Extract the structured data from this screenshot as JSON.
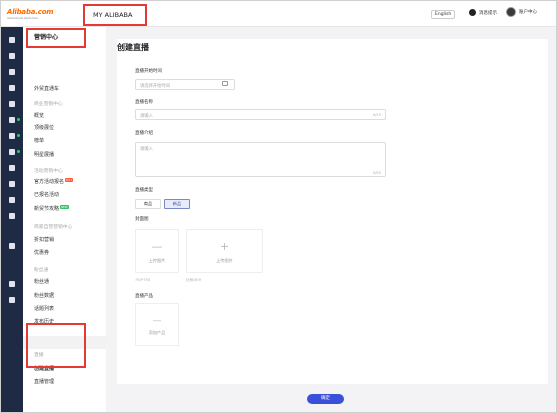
{
  "brand": {
    "logo_text": "Alibaba.com",
    "logo_sub": "Global trade starts here"
  },
  "header": {
    "app_title": "MY ALIBABA",
    "language": "English",
    "messages": "消息提示",
    "user": "账户中心"
  },
  "sidebar": {
    "title": "营销中心",
    "items": [
      {
        "kind": "item",
        "label": "外贸直通车"
      },
      {
        "kind": "group",
        "label": "商业营销中心"
      },
      {
        "kind": "item",
        "label": "概览"
      },
      {
        "kind": "item",
        "label": "顶级展位"
      },
      {
        "kind": "item",
        "label": "榜单"
      },
      {
        "kind": "item",
        "label": "明星展播"
      },
      {
        "kind": "group",
        "label": "活动营销中心"
      },
      {
        "kind": "item",
        "label": "官方活动报名",
        "tag": "HOT",
        "tag_color": "red"
      },
      {
        "kind": "item",
        "label": "已报名活动"
      },
      {
        "kind": "item",
        "label": "新贸节攻略",
        "tag": "NEW",
        "tag_color": "green"
      },
      {
        "kind": "group",
        "label": "商家自营营销中心"
      },
      {
        "kind": "item",
        "label": "折扣营销"
      },
      {
        "kind": "item",
        "label": "优惠券"
      },
      {
        "kind": "group",
        "label": "粉丝通"
      },
      {
        "kind": "item",
        "label": "粉丝通"
      },
      {
        "kind": "item",
        "label": "粉丝数据"
      },
      {
        "kind": "item",
        "label": "话题列表"
      },
      {
        "kind": "item",
        "label": "发布历史"
      },
      {
        "kind": "group",
        "label": "直播"
      },
      {
        "kind": "item",
        "label": "创建直播",
        "active": true
      },
      {
        "kind": "item",
        "label": "直播管理"
      }
    ]
  },
  "form": {
    "page_title": "创建直播",
    "start_time_label": "直播开始时间",
    "start_time_placeholder": "请选择开始时间",
    "name_label": "直播名称",
    "name_placeholder": "请输入",
    "name_counter": "0/15",
    "intro_label": "直播介绍",
    "intro_placeholder": "请输入",
    "intro_counter": "0/50",
    "type_label": "直播类型",
    "type_options": [
      "商品",
      "新品"
    ],
    "type_selected": "新品",
    "cover_label": "封面图",
    "upload_label": "上传图片",
    "cover_hint_1": "750*750",
    "cover_hint_2": "比例16:9",
    "product_label": "直播产品",
    "product_add_label": "添加产品",
    "confirm_label": "确定"
  },
  "colors": {
    "accent": "#3b50d8",
    "highlight": "#e53935",
    "rail": "#1f2a44"
  }
}
